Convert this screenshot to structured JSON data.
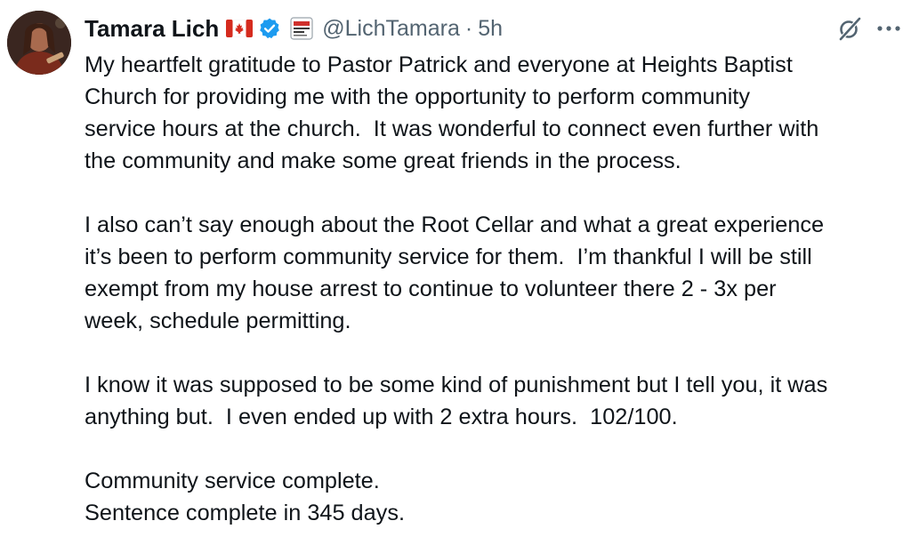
{
  "tweet": {
    "author": {
      "display_name": "Tamara Lich",
      "handle": "@LichTamara",
      "avatar_icon": "profile-photo",
      "flag_icon": "canada-flag-icon",
      "verified_icon": "verified-badge-icon",
      "affiliate_icon": "affiliate-news-badge-icon"
    },
    "separator": "·",
    "timestamp": "5h",
    "actions": {
      "grok_icon": "grok-icon",
      "more_icon": "more-options-icon"
    },
    "colors": {
      "text": "#0f1419",
      "secondary": "#536471",
      "verified": "#1d9bf0"
    },
    "paragraphs": [
      {
        "lines": [
          "My heartfelt gratitude to Pastor Patrick and everyone at Heights Baptist",
          "Church for providing me with the opportunity to perform community",
          "service hours at the church.  It was wonderful to connect even further with",
          "the community and make some great friends in the process."
        ]
      },
      {
        "lines": [
          "I also can’t say enough about the Root Cellar and what a great experience",
          "it’s been to perform community service for them.  I’m thankful I will be still",
          "exempt from my house arrest to continue to volunteer there 2 - 3x per",
          "week, schedule permitting."
        ]
      },
      {
        "lines": [
          "I know it was supposed to be some kind of punishment but I tell you, it was",
          "anything but.  I even ended up with 2 extra hours.  102/100."
        ]
      },
      {
        "lines": [
          "Community service complete.",
          "Sentence complete in 345 days."
        ]
      }
    ]
  }
}
